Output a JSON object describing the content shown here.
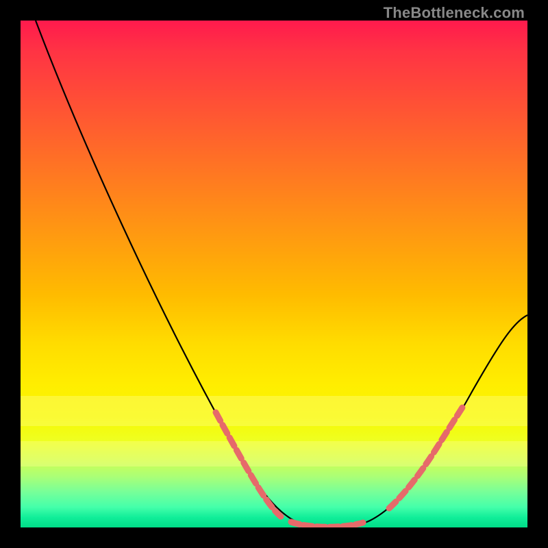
{
  "watermark": "TheBottleneck.com",
  "chart_data": {
    "type": "line",
    "title": "",
    "xlabel": "",
    "ylabel": "",
    "xlim": [
      0,
      100
    ],
    "ylim": [
      0,
      100
    ],
    "series": [
      {
        "name": "curve",
        "x": [
          3,
          10,
          20,
          30,
          38,
          44,
          50,
          55,
          61,
          67,
          73,
          80,
          88,
          94,
          100
        ],
        "y": [
          100,
          86,
          66,
          47,
          31,
          20,
          10,
          3,
          0,
          0,
          3,
          10,
          22,
          32,
          42
        ]
      }
    ],
    "highlighted_segments": {
      "left_descent_y_range": [
        3,
        22
      ],
      "right_ascent_y_range": [
        3,
        22
      ],
      "valley_y_range": [
        0,
        3
      ]
    },
    "background_bands_y": [
      {
        "from": 20,
        "to": 26,
        "color": "pale-yellow"
      },
      {
        "from": 12,
        "to": 17,
        "color": "pale-yellow"
      }
    ],
    "colors": {
      "curve": "#000000",
      "highlight": "#e66a6a",
      "gradient_top": "#ff1a4d",
      "gradient_bottom": "#00dd88"
    }
  }
}
